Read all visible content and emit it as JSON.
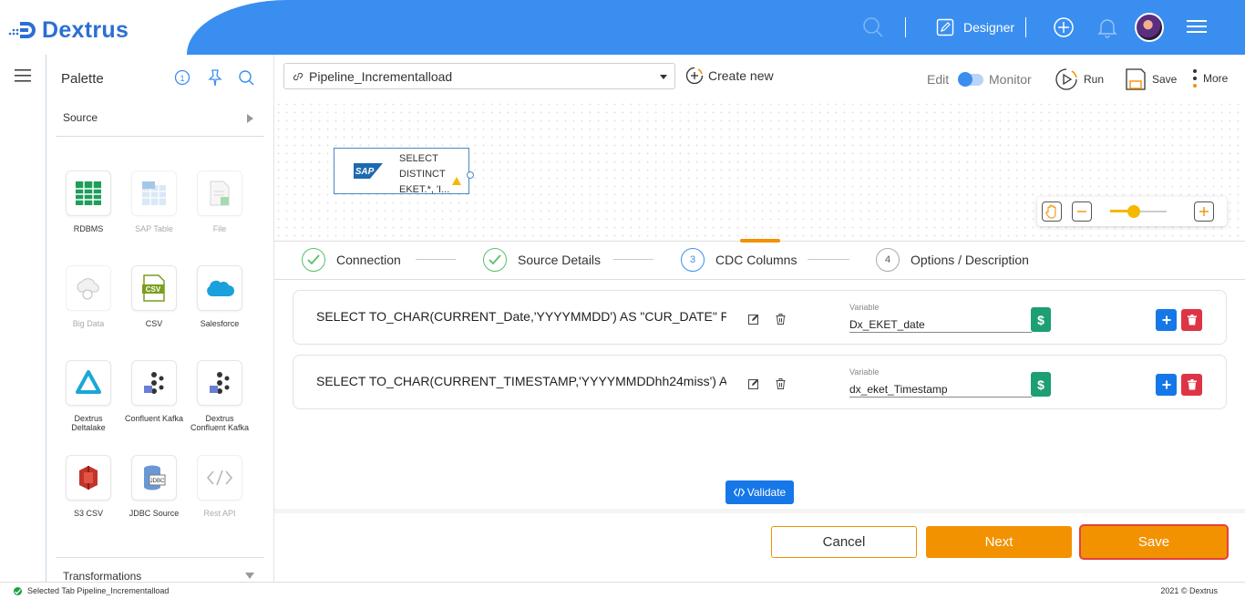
{
  "app": {
    "name": "Dextrus"
  },
  "header": {
    "designer_label": "Designer"
  },
  "palette": {
    "title": "Palette",
    "source_label": "Source",
    "transformations_label": "Transformations",
    "tiles": [
      {
        "label": "RDBMS",
        "icon": "rdbms-icon",
        "enabled": true
      },
      {
        "label": "SAP Table",
        "icon": "sap-table-icon",
        "enabled": false
      },
      {
        "label": "File",
        "icon": "file-icon",
        "enabled": false
      },
      {
        "label": "Big Data",
        "icon": "big-data-icon",
        "enabled": false
      },
      {
        "label": "CSV",
        "icon": "csv-icon",
        "enabled": true
      },
      {
        "label": "Salesforce",
        "icon": "salesforce-icon",
        "enabled": true
      },
      {
        "label": "Dextrus Deltalake",
        "icon": "deltalake-icon",
        "enabled": true
      },
      {
        "label": "Confluent Kafka",
        "icon": "kafka-icon",
        "enabled": true
      },
      {
        "label": "Dextrus Confluent Kafka",
        "icon": "kafka-icon",
        "enabled": true
      },
      {
        "label": "S3 CSV",
        "icon": "s3-icon",
        "enabled": true
      },
      {
        "label": "JDBC Source",
        "icon": "jdbc-icon",
        "enabled": true
      },
      {
        "label": "Rest API",
        "icon": "code-icon",
        "enabled": false
      }
    ]
  },
  "toolbar": {
    "pipeline": "Pipeline_Incrementalload",
    "create_new": "Create new",
    "edit": "Edit",
    "monitor": "Monitor",
    "run": "Run",
    "save": "Save",
    "more": "More"
  },
  "canvas": {
    "node_text": "SELECT\nDISTINCT\nEKET.*, 'I..."
  },
  "steps": [
    {
      "num": "1",
      "label": "Connection",
      "state": "done"
    },
    {
      "num": "2",
      "label": "Source Details",
      "state": "done"
    },
    {
      "num": "3",
      "label": "CDC Columns",
      "state": "active"
    },
    {
      "num": "4",
      "label": "Options / Description",
      "state": "pending"
    }
  ],
  "cdc_rows": [
    {
      "query": "SELECT TO_CHAR(CURRENT_Date,'YYYYMMDD') AS \"CUR_DATE\" F...",
      "variable_label": "Variable",
      "variable": "Dx_EKET_date"
    },
    {
      "query": "SELECT TO_CHAR(CURRENT_TIMESTAMP,'YYYYMMDDhh24miss') A...",
      "variable_label": "Variable",
      "variable": "dx_eket_Timestamp"
    }
  ],
  "validate_label": "Validate",
  "footer": {
    "cancel": "Cancel",
    "next": "Next",
    "save": "Save"
  },
  "status": {
    "text": "Selected Tab Pipeline_Incrementalload",
    "copyright": "2021 © Dextrus"
  },
  "colors": {
    "brand_blue": "#3a8ef0",
    "accent_orange": "#f39200",
    "success_green": "#56c16b",
    "danger_red": "#dd3546"
  }
}
